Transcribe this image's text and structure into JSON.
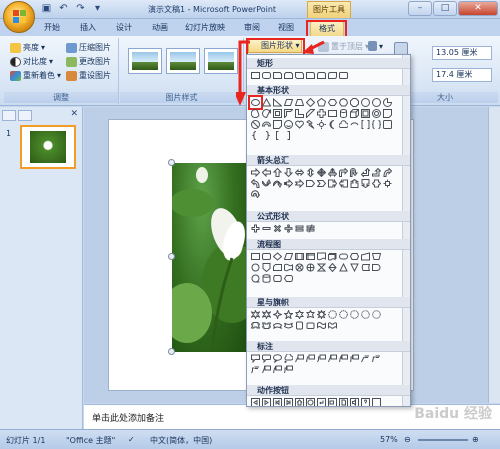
{
  "titlebar": {
    "title": "演示文稿1 - Microsoft PowerPoint",
    "context_tab": "图片工具"
  },
  "tabs": {
    "items": [
      {
        "label": "开始"
      },
      {
        "label": "插入"
      },
      {
        "label": "设计"
      },
      {
        "label": "动画"
      },
      {
        "label": "幻灯片放映"
      },
      {
        "label": "审阅"
      },
      {
        "label": "视图"
      },
      {
        "label": "格式"
      }
    ]
  },
  "ribbon": {
    "adjust": {
      "brightness": "亮度",
      "contrast": "对比度",
      "recolor": "重新着色",
      "compress": "压缩图片",
      "change_picture": "更改图片",
      "reset_picture": "重设图片",
      "group_label": "调整"
    },
    "picture_styles_label": "图片样式",
    "picture_shape": "图片形状",
    "bring_forward": "置于顶层",
    "size": {
      "height": "13.05 厘米",
      "width": "17.4 厘米",
      "group_label": "大小"
    }
  },
  "gallery": {
    "sections": [
      {
        "title": "矩形"
      },
      {
        "title": "基本形状"
      },
      {
        "title": "箭头总汇"
      },
      {
        "title": "公式形状"
      },
      {
        "title": "流程图"
      },
      {
        "title": "星与旗帜"
      },
      {
        "title": "标注"
      },
      {
        "title": "动作按钮"
      }
    ]
  },
  "notes": {
    "placeholder": "单击此处添加备注"
  },
  "status": {
    "slide": "幻灯片 1/1",
    "theme": "\"Office 主题\"",
    "language": "中文(简体，中国)",
    "zoom": "57%"
  },
  "watermark": "Baidu 经验"
}
